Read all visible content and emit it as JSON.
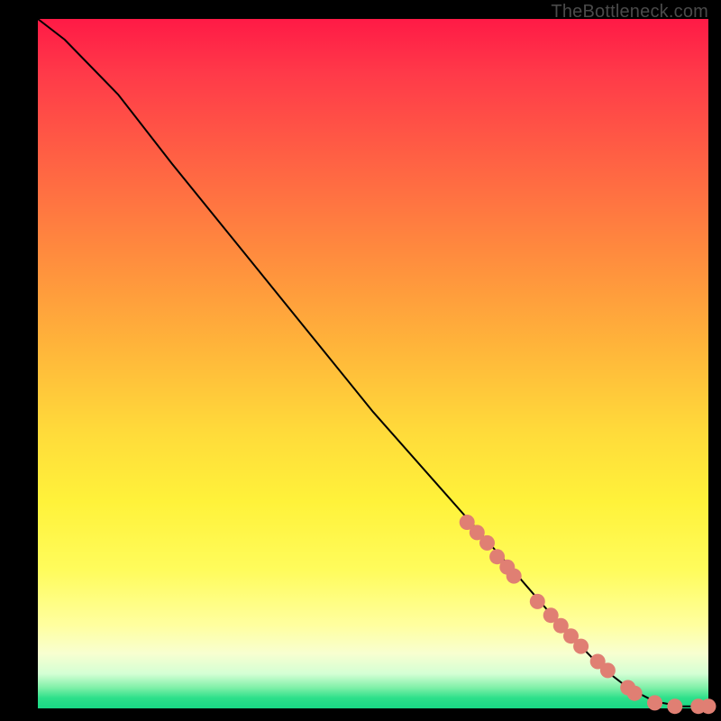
{
  "watermark": "TheBottleneck.com",
  "chart_data": {
    "type": "line",
    "title": "",
    "xlabel": "",
    "ylabel": "",
    "xlim": [
      0,
      100
    ],
    "ylim": [
      0,
      100
    ],
    "series": [
      {
        "name": "curve",
        "x": [
          0,
          4,
          8,
          12,
          20,
          30,
          40,
          50,
          60,
          70,
          78,
          84,
          88,
          92,
          96,
          100
        ],
        "y": [
          100,
          97,
          93,
          89,
          79,
          67,
          55,
          43,
          32,
          21,
          12,
          6,
          3,
          1,
          0.3,
          0.3
        ]
      }
    ],
    "markers": [
      {
        "x": 64,
        "y": 27
      },
      {
        "x": 65.5,
        "y": 25.5
      },
      {
        "x": 67,
        "y": 24
      },
      {
        "x": 68.5,
        "y": 22
      },
      {
        "x": 70,
        "y": 20.5
      },
      {
        "x": 71,
        "y": 19.2
      },
      {
        "x": 74.5,
        "y": 15.5
      },
      {
        "x": 76.5,
        "y": 13.5
      },
      {
        "x": 78,
        "y": 12
      },
      {
        "x": 79.5,
        "y": 10.5
      },
      {
        "x": 81,
        "y": 9
      },
      {
        "x": 83.5,
        "y": 6.8
      },
      {
        "x": 85,
        "y": 5.5
      },
      {
        "x": 88,
        "y": 3
      },
      {
        "x": 89,
        "y": 2.2
      },
      {
        "x": 92,
        "y": 0.8
      },
      {
        "x": 95,
        "y": 0.3
      },
      {
        "x": 98.5,
        "y": 0.3
      },
      {
        "x": 100,
        "y": 0.3
      }
    ],
    "colors": {
      "curve": "#000000",
      "marker_fill": "#e07f73",
      "marker_stroke": "#d46a5e"
    }
  }
}
